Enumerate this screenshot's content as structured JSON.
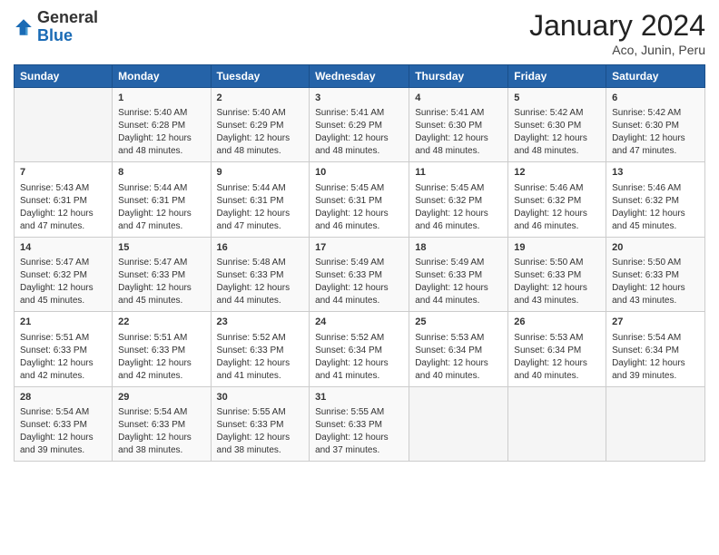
{
  "logo": {
    "general": "General",
    "blue": "Blue"
  },
  "header": {
    "month": "January 2024",
    "location": "Aco, Junin, Peru"
  },
  "weekdays": [
    "Sunday",
    "Monday",
    "Tuesday",
    "Wednesday",
    "Thursday",
    "Friday",
    "Saturday"
  ],
  "rows": [
    [
      {
        "day": "",
        "content": ""
      },
      {
        "day": "1",
        "content": "Sunrise: 5:40 AM\nSunset: 6:28 PM\nDaylight: 12 hours\nand 48 minutes."
      },
      {
        "day": "2",
        "content": "Sunrise: 5:40 AM\nSunset: 6:29 PM\nDaylight: 12 hours\nand 48 minutes."
      },
      {
        "day": "3",
        "content": "Sunrise: 5:41 AM\nSunset: 6:29 PM\nDaylight: 12 hours\nand 48 minutes."
      },
      {
        "day": "4",
        "content": "Sunrise: 5:41 AM\nSunset: 6:30 PM\nDaylight: 12 hours\nand 48 minutes."
      },
      {
        "day": "5",
        "content": "Sunrise: 5:42 AM\nSunset: 6:30 PM\nDaylight: 12 hours\nand 48 minutes."
      },
      {
        "day": "6",
        "content": "Sunrise: 5:42 AM\nSunset: 6:30 PM\nDaylight: 12 hours\nand 47 minutes."
      }
    ],
    [
      {
        "day": "7",
        "content": "Sunrise: 5:43 AM\nSunset: 6:31 PM\nDaylight: 12 hours\nand 47 minutes."
      },
      {
        "day": "8",
        "content": "Sunrise: 5:44 AM\nSunset: 6:31 PM\nDaylight: 12 hours\nand 47 minutes."
      },
      {
        "day": "9",
        "content": "Sunrise: 5:44 AM\nSunset: 6:31 PM\nDaylight: 12 hours\nand 47 minutes."
      },
      {
        "day": "10",
        "content": "Sunrise: 5:45 AM\nSunset: 6:31 PM\nDaylight: 12 hours\nand 46 minutes."
      },
      {
        "day": "11",
        "content": "Sunrise: 5:45 AM\nSunset: 6:32 PM\nDaylight: 12 hours\nand 46 minutes."
      },
      {
        "day": "12",
        "content": "Sunrise: 5:46 AM\nSunset: 6:32 PM\nDaylight: 12 hours\nand 46 minutes."
      },
      {
        "day": "13",
        "content": "Sunrise: 5:46 AM\nSunset: 6:32 PM\nDaylight: 12 hours\nand 45 minutes."
      }
    ],
    [
      {
        "day": "14",
        "content": "Sunrise: 5:47 AM\nSunset: 6:32 PM\nDaylight: 12 hours\nand 45 minutes."
      },
      {
        "day": "15",
        "content": "Sunrise: 5:47 AM\nSunset: 6:33 PM\nDaylight: 12 hours\nand 45 minutes."
      },
      {
        "day": "16",
        "content": "Sunrise: 5:48 AM\nSunset: 6:33 PM\nDaylight: 12 hours\nand 44 minutes."
      },
      {
        "day": "17",
        "content": "Sunrise: 5:49 AM\nSunset: 6:33 PM\nDaylight: 12 hours\nand 44 minutes."
      },
      {
        "day": "18",
        "content": "Sunrise: 5:49 AM\nSunset: 6:33 PM\nDaylight: 12 hours\nand 44 minutes."
      },
      {
        "day": "19",
        "content": "Sunrise: 5:50 AM\nSunset: 6:33 PM\nDaylight: 12 hours\nand 43 minutes."
      },
      {
        "day": "20",
        "content": "Sunrise: 5:50 AM\nSunset: 6:33 PM\nDaylight: 12 hours\nand 43 minutes."
      }
    ],
    [
      {
        "day": "21",
        "content": "Sunrise: 5:51 AM\nSunset: 6:33 PM\nDaylight: 12 hours\nand 42 minutes."
      },
      {
        "day": "22",
        "content": "Sunrise: 5:51 AM\nSunset: 6:33 PM\nDaylight: 12 hours\nand 42 minutes."
      },
      {
        "day": "23",
        "content": "Sunrise: 5:52 AM\nSunset: 6:33 PM\nDaylight: 12 hours\nand 41 minutes."
      },
      {
        "day": "24",
        "content": "Sunrise: 5:52 AM\nSunset: 6:34 PM\nDaylight: 12 hours\nand 41 minutes."
      },
      {
        "day": "25",
        "content": "Sunrise: 5:53 AM\nSunset: 6:34 PM\nDaylight: 12 hours\nand 40 minutes."
      },
      {
        "day": "26",
        "content": "Sunrise: 5:53 AM\nSunset: 6:34 PM\nDaylight: 12 hours\nand 40 minutes."
      },
      {
        "day": "27",
        "content": "Sunrise: 5:54 AM\nSunset: 6:34 PM\nDaylight: 12 hours\nand 39 minutes."
      }
    ],
    [
      {
        "day": "28",
        "content": "Sunrise: 5:54 AM\nSunset: 6:33 PM\nDaylight: 12 hours\nand 39 minutes."
      },
      {
        "day": "29",
        "content": "Sunrise: 5:54 AM\nSunset: 6:33 PM\nDaylight: 12 hours\nand 38 minutes."
      },
      {
        "day": "30",
        "content": "Sunrise: 5:55 AM\nSunset: 6:33 PM\nDaylight: 12 hours\nand 38 minutes."
      },
      {
        "day": "31",
        "content": "Sunrise: 5:55 AM\nSunset: 6:33 PM\nDaylight: 12 hours\nand 37 minutes."
      },
      {
        "day": "",
        "content": ""
      },
      {
        "day": "",
        "content": ""
      },
      {
        "day": "",
        "content": ""
      }
    ]
  ]
}
